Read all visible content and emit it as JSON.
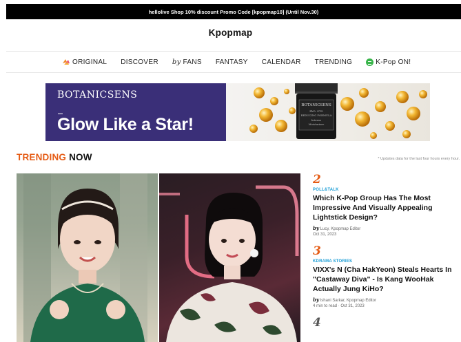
{
  "promo": {
    "text": "hellolive Shop 10% discount Promo Code [kpopmap10] (Until Nov.30)"
  },
  "logo": "Kpopmap",
  "nav": {
    "original": "ORIGINAL",
    "discover": "DISCOVER",
    "by_fans_by": "by",
    "by_fans_label": "FANS",
    "fantasy": "FANTASY",
    "calendar": "CALENDAR",
    "trending": "TRENDING",
    "kpop_on": "K-Pop ON!"
  },
  "banner": {
    "brand": "BOTANICSENS",
    "headline": "Glow Like a Star!",
    "jar_brand": "BOTANICSENS",
    "jar_line1": "PhD. STO",
    "jar_line2": "REDUCING FORMULA",
    "jar_line3": "Intense",
    "jar_line4": "Moisturizer"
  },
  "trending": {
    "title_accent": "TRENDING",
    "title_rest": "NOW",
    "note": "* Updates data for the last four hours every hour."
  },
  "articles": [
    {
      "rank": "2",
      "category": "POLL&TALK",
      "title": "Which K-Pop Group Has The Most Impressive And Visually Appealing Lightstick Design?",
      "by": "by",
      "author": "Lucy, Kpopmap Editor",
      "date": "Oct 31, 2023"
    },
    {
      "rank": "3",
      "category": "KDRAMA STORIES",
      "title": "VIXX's N (Cha HakYeon) Steals Hearts In \"Castaway Diva\" - Is Kang WooHak Actually Jung KiHo?",
      "by": "by",
      "author": "Ishani Sarkar, Kpopmap Editor",
      "date": "4 min to read · Oct 31, 2023"
    },
    {
      "rank": "4"
    }
  ],
  "colors": {
    "accent": "#e55b14",
    "category": "#1a9dd6",
    "banner_bg": "#3a2f78",
    "kpop_on_icon": "#39b54a"
  }
}
